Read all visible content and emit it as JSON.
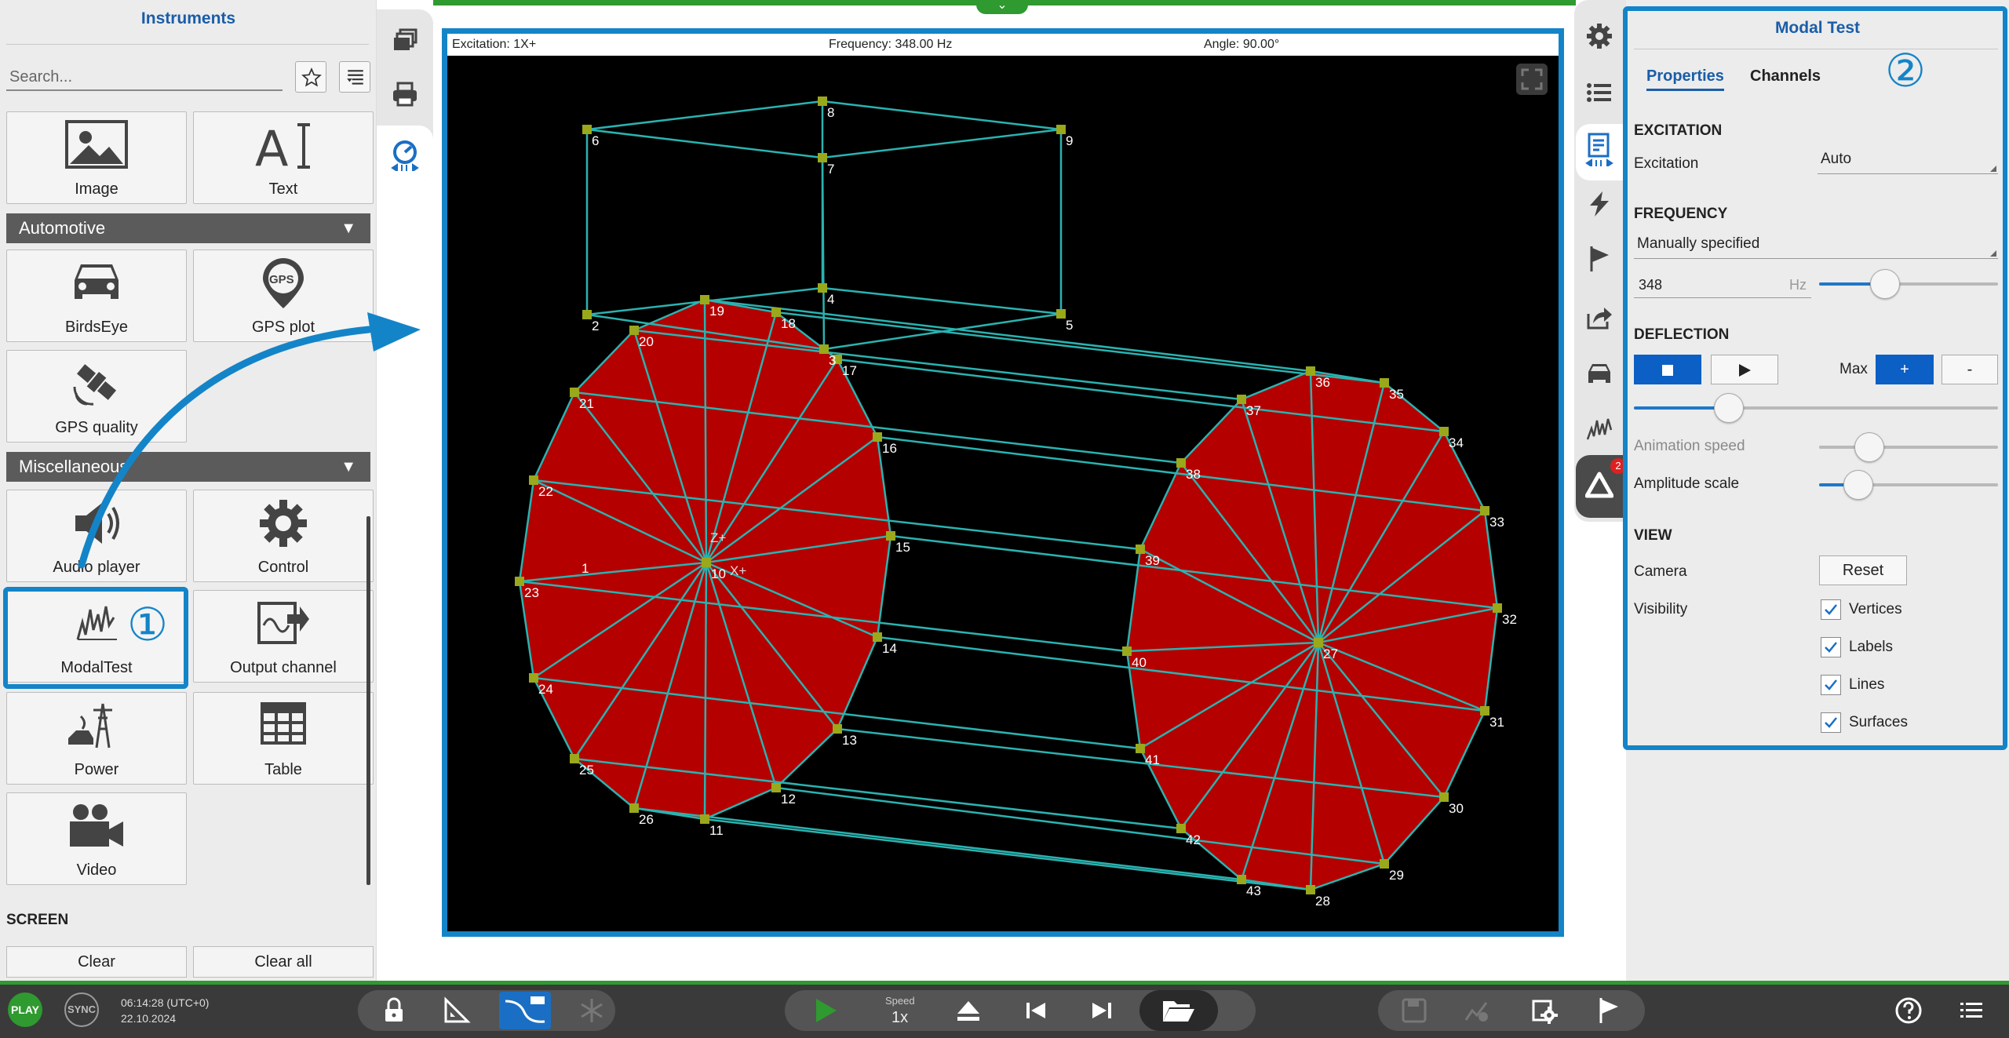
{
  "left_panel": {
    "title": "Instruments",
    "search_placeholder": "Search...",
    "tiles_top": [
      {
        "label": "Image",
        "icon": "image-icon"
      },
      {
        "label": "Text",
        "icon": "text-icon"
      }
    ],
    "categories": [
      {
        "label": "Automotive",
        "tiles": [
          {
            "label": "BirdsEye",
            "icon": "car-icon"
          },
          {
            "label": "GPS plot",
            "icon": "gps-pin-icon"
          },
          {
            "label": "GPS quality",
            "icon": "satellite-icon"
          }
        ]
      },
      {
        "label": "Miscellaneous",
        "tiles": [
          {
            "label": "Audio player",
            "icon": "speaker-icon"
          },
          {
            "label": "Control",
            "icon": "gear-icon"
          },
          {
            "label": "ModalTest",
            "icon": "modal-test-icon"
          },
          {
            "label": "Output channel",
            "icon": "output-channel-icon"
          },
          {
            "label": "Power",
            "icon": "power-icon"
          },
          {
            "label": "Table",
            "icon": "table-icon"
          },
          {
            "label": "Video",
            "icon": "video-camera-icon"
          }
        ]
      }
    ],
    "screen_label": "SCREEN",
    "clear_label": "Clear",
    "clear_all_label": "Clear all"
  },
  "annotations": {
    "marker1": "①",
    "marker2": "②"
  },
  "viewport": {
    "excitation": "Excitation: 1X+",
    "frequency": "Frequency: 348.00 Hz",
    "angle": "Angle: 90.00°",
    "node_labels": [
      "1",
      "2",
      "3",
      "4",
      "5",
      "6",
      "7",
      "8",
      "9",
      "10",
      "11",
      "12",
      "13",
      "14",
      "15",
      "16",
      "17",
      "18",
      "19",
      "20",
      "21",
      "22",
      "23",
      "24",
      "25",
      "26",
      "27",
      "28",
      "29",
      "30",
      "31",
      "32",
      "33",
      "34",
      "35",
      "36",
      "37",
      "38",
      "39",
      "40",
      "41",
      "42",
      "43"
    ],
    "axis_labels": [
      "Z+",
      "X+"
    ],
    "colors": {
      "wire": "#2ab3b0",
      "surface": "#b50000",
      "vertex": "#9aa81c",
      "label": "#ffffff"
    }
  },
  "right_panel": {
    "title": "Modal Test",
    "tabs": [
      "Properties",
      "Channels"
    ],
    "excitation": {
      "section": "EXCITATION",
      "label": "Excitation",
      "value": "Auto"
    },
    "frequency": {
      "section": "FREQUENCY",
      "mode": "Manually specified",
      "value": "348",
      "unit": "Hz",
      "slider_fraction": 0.37
    },
    "deflection": {
      "section": "DEFLECTION",
      "max_label": "Max",
      "plus": "+",
      "minus": "-",
      "slider_fraction": 0.26
    },
    "animation_speed": {
      "label": "Animation speed",
      "slider_fraction": 0.28
    },
    "amplitude_scale": {
      "label": "Amplitude scale",
      "slider_fraction": 0.22
    },
    "view": {
      "section": "VIEW",
      "camera_label": "Camera",
      "reset_label": "Reset",
      "visibility_label": "Visibility",
      "checks": [
        {
          "label": "Vertices",
          "checked": true
        },
        {
          "label": "Labels",
          "checked": true
        },
        {
          "label": "Lines",
          "checked": true
        },
        {
          "label": "Surfaces",
          "checked": true
        }
      ]
    }
  },
  "bottom_bar": {
    "play": "PLAY",
    "sync": "SYNC",
    "time": "06:14:28 (UTC+0)",
    "date": "22.10.2024",
    "speed_label": "Speed",
    "speed_value": "1x",
    "badge": "2",
    "accent": "#2f9a2f"
  }
}
